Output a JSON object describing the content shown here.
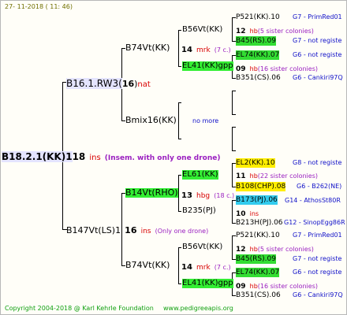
{
  "header": {
    "date": "27- 11-2018 ( 11: 46)"
  },
  "root": {
    "label": "B18.2.1(KK)1",
    "num": "18",
    "suffix": "ins",
    "note": "(Insem. with only one drone)"
  },
  "upper_parent": {
    "label": "B16.1.RW3(",
    "num": "16",
    "suffix": "nat"
  },
  "upper_a": {
    "label": "B74Vt(KK)",
    "num": "14",
    "suffix": "mrk",
    "note": "(7 c.)"
  },
  "upper_b": {
    "label": "Bmix16(KK)",
    "note": "no more"
  },
  "upper_a_1": {
    "label": "B56Vt(KK)"
  },
  "upper_a_2": {
    "label": "EL41(KK)gpp"
  },
  "ua1_children": [
    {
      "label": "P521(KK).10",
      "right": "G7 - PrimRed01",
      "bg": ""
    },
    {
      "label_num": "12",
      "label_suffix": "hb",
      "label_note": "(5 sister colonies)",
      "right": "",
      "bg": ""
    },
    {
      "label": "B45(RS).09",
      "right": "G7 - not registe",
      "bg": "green"
    }
  ],
  "ua2_children": [
    {
      "label": "EL74(KK).07",
      "right": "G6 - not registe",
      "bg": "green"
    },
    {
      "label_num": "09",
      "label_suffix": "hb",
      "label_note": "(16 sister colonies)",
      "right": "",
      "bg": ""
    },
    {
      "label": "B351(CS).06",
      "right": "G6 - Cankiri97Q",
      "bg": ""
    }
  ],
  "lower_parent": {
    "label": "B147Vt(LS)1",
    "num": "16",
    "suffix": "ins",
    "note": "(Only one drone)"
  },
  "lower_a": {
    "label": "B14Vt(RHO)",
    "num": "13",
    "suffix": "hbg",
    "note": "(18 c.)"
  },
  "lower_a_1": {
    "label": "EL61(KK)"
  },
  "lower_a_2": {
    "label": "B235(PJ)"
  },
  "la1_children": [
    {
      "label": "EL2(KK).10",
      "right": "G8 - not registe",
      "bg": "yellow"
    },
    {
      "label_num": "11",
      "label_suffix": "hb",
      "label_note": "(22 sister colonies)",
      "right": "",
      "bg": ""
    },
    {
      "label": "B108(CHP).08",
      "right": "G6 - B262(NE)",
      "bg": "yellow"
    }
  ],
  "la2_children": [
    {
      "label": "B173(PJ).06",
      "right": "G14 - AthosSt80R",
      "bg": "cyan"
    },
    {
      "label_num": "10",
      "label_suffix": "ins",
      "label_note": "",
      "right": "",
      "bg": ""
    },
    {
      "label": "B213H(PJ).06",
      "right": "G12 - SinopEgg86R",
      "bg": ""
    }
  ],
  "lower_b": {
    "label": "B74Vt(KK)",
    "num": "14",
    "suffix": "mrk",
    "note": "(7 c.)"
  },
  "lower_b_1": {
    "label": "B56Vt(KK)"
  },
  "lower_b_2": {
    "label": "EL41(KK)gpp"
  },
  "lb1_children": [
    {
      "label": "P521(KK).10",
      "right": "G7 - PrimRed01",
      "bg": ""
    },
    {
      "label_num": "12",
      "label_suffix": "hb",
      "label_note": "(5 sister colonies)",
      "right": "",
      "bg": ""
    },
    {
      "label": "B45(RS).09",
      "right": "G7 - not registe",
      "bg": "green"
    }
  ],
  "lb2_children": [
    {
      "label": "EL74(KK).07",
      "right": "G6 - not registe",
      "bg": "green"
    },
    {
      "label_num": "09",
      "label_suffix": "hb",
      "label_note": "(16 sister colonies)",
      "right": "",
      "bg": ""
    },
    {
      "label": "B351(CS).06",
      "right": "G6 - Cankiri97Q",
      "bg": ""
    }
  ],
  "footer": {
    "copyright": "Copyright 2004-2018 @ Karl Kehrle Foundation",
    "url": "www.pedigreeapis.org"
  }
}
